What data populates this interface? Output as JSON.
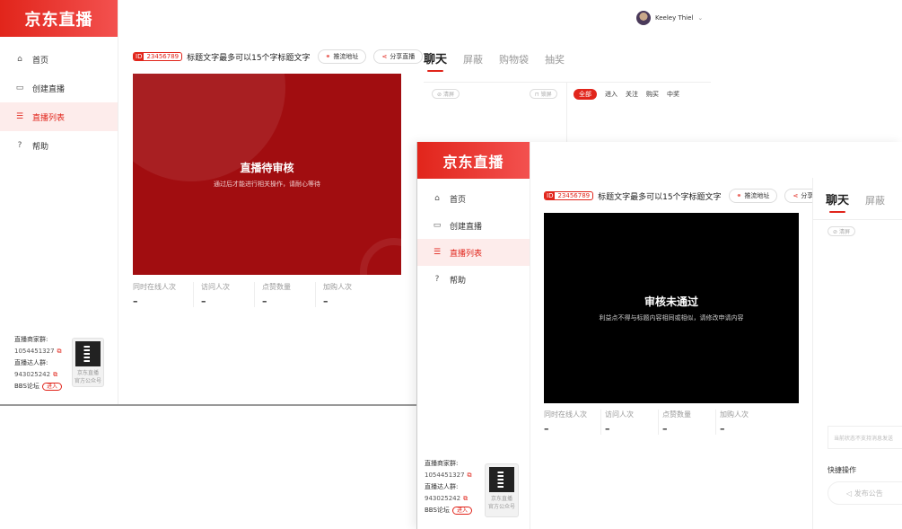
{
  "brand": "京东直播",
  "user": {
    "name": "Keeley Thiel"
  },
  "nav": [
    {
      "icon": "home-icon",
      "glyph": "⌂",
      "label": "首页"
    },
    {
      "icon": "video-camera-icon",
      "glyph": "▭",
      "label": "创建直播"
    },
    {
      "icon": "list-icon",
      "glyph": "☰",
      "label": "直播列表"
    },
    {
      "icon": "help-icon",
      "glyph": "?",
      "label": "帮助"
    }
  ],
  "footer": {
    "merchant_group_label": "直播商家群:",
    "merchant_group_id": "1054451327",
    "talent_group_label": "直播达人群:",
    "talent_group_id": "943025242",
    "bbs_label": "BBS论坛",
    "bbs_enter": "进入",
    "qr_caption_1": "京东直播",
    "qr_caption_2": "官方公众号"
  },
  "stream": {
    "id_tag": "ID",
    "id": "23456789",
    "title": "标题文字最多可以15个字标题文字",
    "pull_button": "推流地址",
    "share_button": "分享直播"
  },
  "window1": {
    "video_title": "直播待审核",
    "video_sub": "通过后才能进行相关操作，请耐心等待"
  },
  "window2": {
    "video_title": "审核未通过",
    "video_sub": "利益点不得与标题内容相同或相似，请修改申请内容"
  },
  "stats": [
    {
      "label": "同时在线人次",
      "value": "–"
    },
    {
      "label": "访问人次",
      "value": "–"
    },
    {
      "label": "点赞数量",
      "value": "–"
    },
    {
      "label": "加购人次",
      "value": "–"
    }
  ],
  "chat_tabs": [
    "聊天",
    "屏蔽",
    "购物袋",
    "抽奖"
  ],
  "chat": {
    "clear": "清屏",
    "lock": "锁屏",
    "filters": [
      "全部",
      "进入",
      "关注",
      "购买",
      "中奖"
    ],
    "unsupported_hint": "当前状态不支持消息发送",
    "quick_ops": "快捷操作",
    "publish_notice": "发布公告"
  },
  "colors": {
    "accent": "#e1251b",
    "video_pending": "#a10d10",
    "video_rejected": "#000000"
  }
}
